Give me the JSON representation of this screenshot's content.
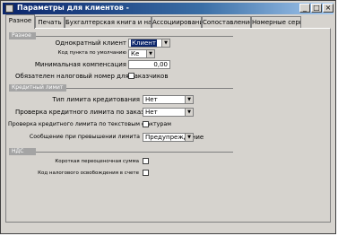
{
  "window": {
    "title": "Параметры для клиентов -",
    "controls": {
      "minimize": "_",
      "maximize": "□",
      "close": "×"
    }
  },
  "tabs": [
    {
      "label": "Разное",
      "active": true
    },
    {
      "label": "Печать"
    },
    {
      "label": "Бухгалтерская книга и налог"
    },
    {
      "label": "Ассоциирования"
    },
    {
      "label": "Сопоставление"
    },
    {
      "label": "Номерные серии"
    }
  ],
  "general": {
    "header": "Разное",
    "one_time_customer": {
      "label": "Однократный клиент",
      "value": "Клиент"
    },
    "term_nums": {
      "label": "Код пункта по умолчанию",
      "value": "Ке"
    },
    "min_compensation": {
      "label": "Минимальная компенсация",
      "value": "0,00"
    },
    "mandatory_tax_number": {
      "label": "Обязателен налоговый номер для заказчиков",
      "checked": false
    }
  },
  "credit": {
    "header": "Кредитный лимит",
    "limit_type": {
      "label": "Тип лимита кредитования",
      "value": "Нет"
    },
    "check_orders": {
      "label": "Проверка кредитного лимита по заказам",
      "value": "Нет"
    },
    "check_free_text": {
      "label": "Проверка кредитного лимита по текстовым фактурам",
      "checked": false
    },
    "message_exceeded": {
      "label": "Сообщение при превышении лимита",
      "value": "Предупреждение"
    }
  },
  "misc": {
    "header": "НДС",
    "opt1": {
      "label": "Короткая переоценочная сумма",
      "checked": false
    },
    "opt2": {
      "label": "Код налогового освобождения в счете",
      "checked": false
    }
  },
  "colors": {
    "face": "#d6d3ce",
    "title_start": "#0a246a",
    "title_end": "#a6caf0",
    "highlight": "#0a246a"
  }
}
